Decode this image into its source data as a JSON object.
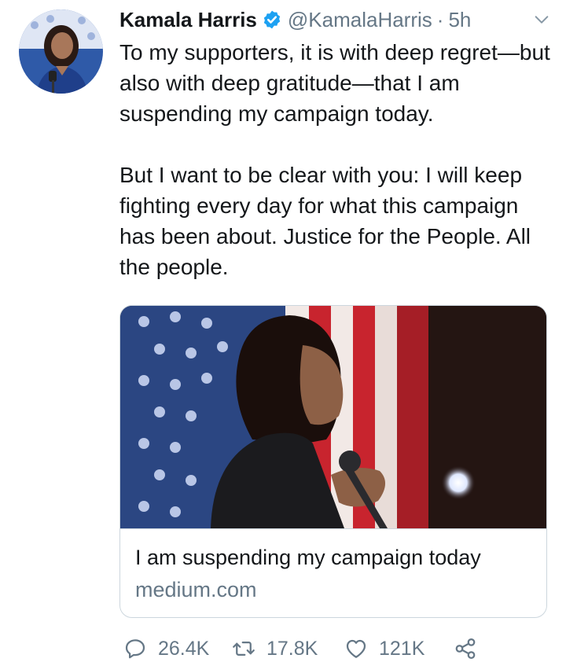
{
  "author": {
    "name": "Kamala Harris",
    "handle": "@KamalaHarris",
    "separator": "·",
    "time": "5h",
    "verified": true
  },
  "tweet": {
    "paragraphs": [
      "To my supporters, it is with deep regret—but also with deep gratitude—that I am suspending my campaign today.",
      "But I want to be clear with you: I will keep fighting every day for what this campaign has been about. Justice for the People. All the people."
    ]
  },
  "link_card": {
    "title": "I am suspending my campaign today",
    "domain": "medium.com"
  },
  "actions": {
    "replies": "26.4K",
    "retweets": "17.8K",
    "likes": "121K"
  },
  "icons": {
    "verified": "verified-badge-icon",
    "caret": "chevron-down-icon",
    "reply": "reply-icon",
    "retweet": "retweet-icon",
    "like": "heart-icon",
    "share": "share-icon"
  },
  "colors": {
    "text": "#14171a",
    "secondary": "#657786",
    "verified_blue": "#1da1f2",
    "border": "#ccd6dd"
  }
}
